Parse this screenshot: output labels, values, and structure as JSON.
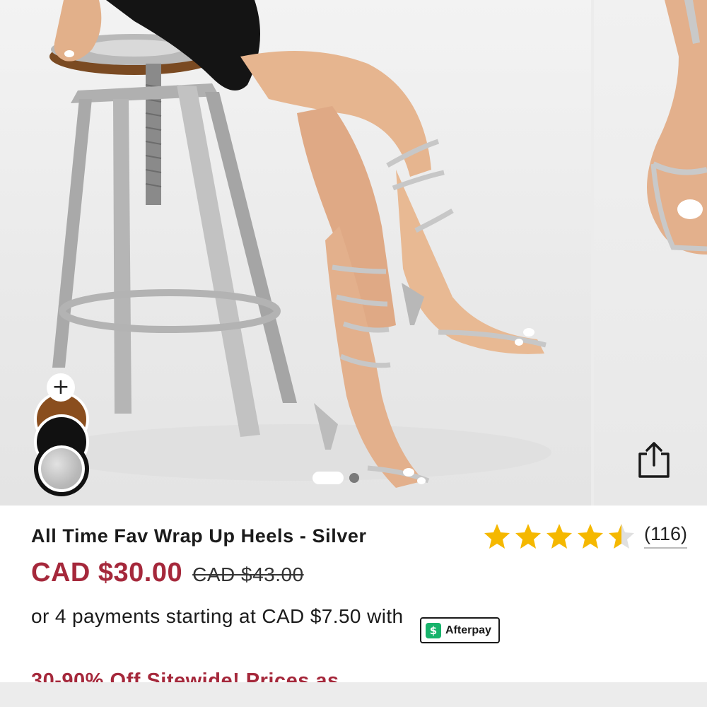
{
  "gallery": {
    "main_image_alt": "",
    "swatches": {
      "add_symbol": "+",
      "colors": [
        "#8a4e1e",
        "#111111",
        "#c2c2c2"
      ]
    },
    "pagination": {
      "active_index": 0,
      "total": 2
    },
    "share_icon": "share-icon"
  },
  "product": {
    "title": "All Time Fav Wrap Up Heels - Silver",
    "rating": {
      "value": 4.5,
      "max": 5,
      "count_label": "(116)",
      "star_color": "#f5b800",
      "empty_star_color": "#e0e0e0"
    },
    "price": {
      "sale": "CAD $30.00",
      "original": "CAD $43.00",
      "sale_color": "#a5283b"
    },
    "installment": {
      "text": "or 4 payments starting at CAD $7.50 with",
      "provider_label": "Afterpay",
      "provider_icon": "$"
    },
    "promo": "30-90% Off Sitewide! Prices as"
  }
}
